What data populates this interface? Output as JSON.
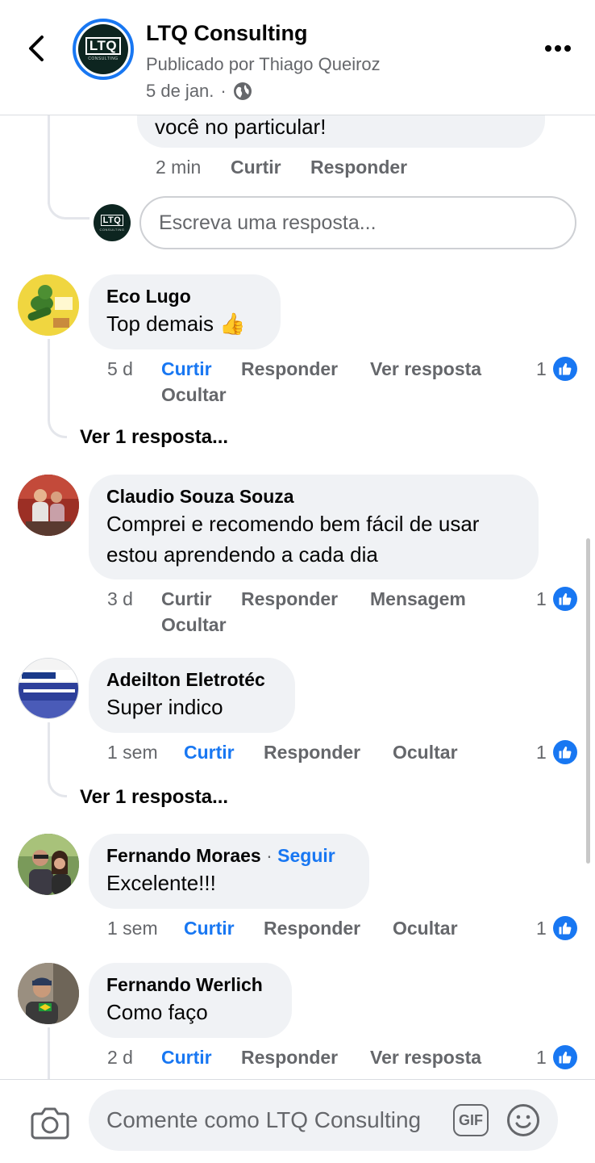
{
  "header": {
    "page_name": "LTQ Consulting",
    "posted_by": "Publicado por Thiago Queiroz",
    "date": "5 de jan.",
    "separator": "·"
  },
  "logo": {
    "text": "LTQ",
    "sub": "CONSULTING"
  },
  "partial_reply": {
    "text": "você no particular!",
    "time": "2 min",
    "like": "Curtir",
    "reply": "Responder"
  },
  "reply_input": {
    "placeholder": "Escreva uma resposta..."
  },
  "comments": [
    {
      "author": "Eco Lugo",
      "text": "Top demais 👍",
      "time": "5 d",
      "like": "Curtir",
      "reply": "Responder",
      "extra": "Ver resposta",
      "hide": "Ocultar",
      "reactions": "1",
      "view_replies": "Ver 1 resposta..."
    },
    {
      "author": "Claudio Souza Souza",
      "text_line1": "Comprei e recomendo bem fácil de usar",
      "text_line2": "estou aprendendo a cada dia",
      "time": "3 d",
      "like": "Curtir",
      "reply": "Responder",
      "extra": "Mensagem",
      "hide": "Ocultar",
      "reactions": "1"
    },
    {
      "author": "Adeilton Eletrotéc",
      "text": "Super indico",
      "time": "1 sem",
      "like": "Curtir",
      "reply": "Responder",
      "hide": "Ocultar",
      "reactions": "1",
      "view_replies": "Ver 1 resposta..."
    },
    {
      "author": "Fernando Moraes",
      "separator": "·",
      "follow": "Seguir",
      "text": "Excelente!!!",
      "time": "1 sem",
      "like": "Curtir",
      "reply": "Responder",
      "hide": "Ocultar",
      "reactions": "1"
    },
    {
      "author": "Fernando Werlich",
      "text": "Como faço",
      "time": "2 d",
      "like": "Curtir",
      "reply": "Responder",
      "extra": "Ver resposta",
      "reactions": "1"
    }
  ],
  "composer": {
    "placeholder": "Comente como LTQ Consulting",
    "gif": "GIF"
  },
  "colors": {
    "accent": "#1877f2",
    "bubble": "#f0f2f5",
    "secondary_text": "#65676b",
    "thread_line": "#e4e6eb"
  },
  "icons": [
    "back-arrow-icon",
    "globe-icon",
    "more-icon",
    "like-icon",
    "camera-icon",
    "gif-icon",
    "emoji-icon"
  ]
}
